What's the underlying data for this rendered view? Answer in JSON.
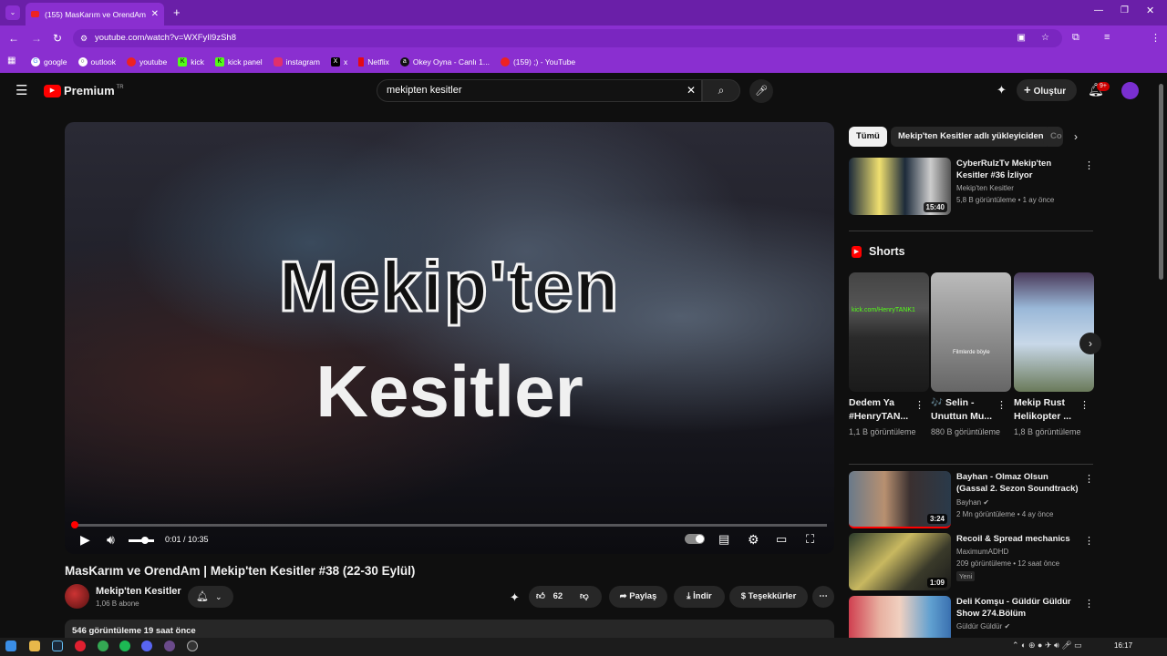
{
  "browser": {
    "tab_title": "(155) MasKarım ve OrendAm | M",
    "url": "youtube.com/watch?v=WXFyIl9zSh8",
    "bookmarks": [
      "google",
      "outlook",
      "youtube",
      "kick",
      "kick panel",
      "instagram",
      "x",
      "Netflix",
      "Okey Oyna - Canlı 1...",
      "(159) ;) - YouTube"
    ]
  },
  "youtube": {
    "logo": "Premium",
    "logo_region": "TR",
    "search_value": "mekipten kesitler",
    "create_label": "Oluştur",
    "notif_badge": "9+"
  },
  "video": {
    "overlay_line1": "Mekip'ten",
    "overlay_line2": "Kesitler",
    "time": "0:01 / 10:35",
    "progress_fraction": 0.002,
    "title": "MasKarım ve OrendAm | Mekip'ten Kesitler #38 (22-30 Eylül)",
    "channel": "Mekip'ten Kesitler",
    "subscribers": "1,06 B abone",
    "likes": "62",
    "share_label": "Paylaş",
    "download_label": "İndir",
    "thanks_label": "Teşekkürler",
    "desc_stats": "546 görüntüleme  19 saat önce"
  },
  "sidebar": {
    "chips": [
      "Tümü",
      "Mekip'ten Kesitler adlı yükleyiciden",
      "Co"
    ],
    "shorts_label": "Shorts",
    "related": [
      {
        "title": "CyberRulzTv Mekip'ten Kesitler #36 İzliyor",
        "channel": "Mekip'ten Kesitler",
        "meta": "5,8 B görüntüleme • 1 ay önce",
        "duration": "15:40"
      },
      {
        "title": "Bayhan - Olmaz Olsun (Gassal 2. Sezon Soundtrack)",
        "channel": "Bayhan",
        "meta": "2 Mn görüntüleme • 4 ay önce",
        "duration": "3:24"
      },
      {
        "title": "Recoil & Spread mechanics",
        "channel": "MaximumADHD",
        "meta": "209 görüntüleme • 12 saat önce",
        "badge": "Yeni",
        "duration": "1:09"
      },
      {
        "title": "Deli Komşu - Güldür Güldür Show 274.Bölüm",
        "channel": "Güldür Güldür",
        "meta": "",
        "duration": ""
      }
    ],
    "shorts": [
      {
        "title": "Dedem Ya #HenryTAN...",
        "views": "1,1 B görüntüleme",
        "overlay": "kick.com/HenryTANK1"
      },
      {
        "title": "🎶 Selin - Unuttun Mu...",
        "views": "880 B görüntüleme",
        "overlay": "Filmlerde böyle"
      },
      {
        "title": "Mekip Rust Helikopter ...",
        "views": "1,8 B görüntüleme",
        "overlay": ""
      }
    ]
  },
  "taskbar": {
    "time": "16:17"
  }
}
